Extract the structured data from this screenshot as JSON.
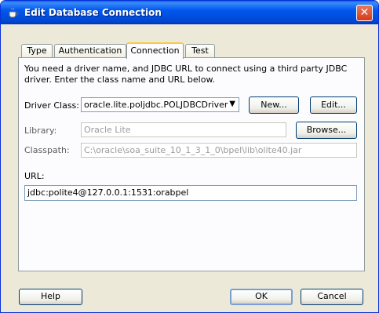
{
  "window": {
    "title": "Edit Database Connection",
    "close_glyph": "✕"
  },
  "tabs": [
    {
      "label": "Type"
    },
    {
      "label": "Authentication"
    },
    {
      "label": "Connection",
      "active": true
    },
    {
      "label": "Test"
    }
  ],
  "intro_text": "You need a driver name, and JDBC URL to connect using a third party JDBC driver. Enter the class name and URL below.",
  "driver_class": {
    "label": "Driver Class:",
    "value": "oracle.lite.poljdbc.POLJDBCDriver",
    "new_button": "New...",
    "edit_button": "Edit..."
  },
  "library": {
    "label": "Library:",
    "value": "Oracle Lite",
    "browse_button": "Browse..."
  },
  "classpath": {
    "label": "Classpath:",
    "value": "C:\\oracle\\soa_suite_10_1_3_1_0\\bpel\\lib\\olite40.jar"
  },
  "url": {
    "label": "URL:",
    "value": "jdbc:polite4@127.0.0.1:1531:orabpel"
  },
  "footer": {
    "help": "Help",
    "ok": "OK",
    "cancel": "Cancel"
  },
  "colors": {
    "titlebar": "#0054e3",
    "dialog_bg": "#ece9d8",
    "close_button": "#d6391a"
  }
}
